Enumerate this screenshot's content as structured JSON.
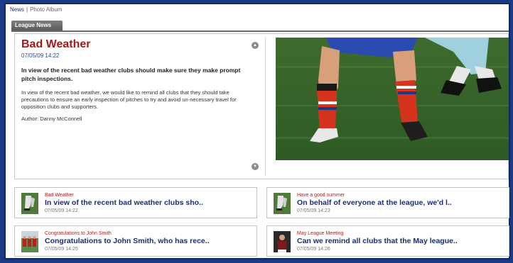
{
  "nav": {
    "news": "News",
    "separator": "|",
    "photo_album": "Photo Album"
  },
  "tab": {
    "label": "League News"
  },
  "feature": {
    "title": "Bad Weather",
    "date": "07/05/09 14:22",
    "lead": "In view of the recent bad weather clubs should make sure they make prompt pitch inspections.",
    "body": "In view of the recent bad weather, we would like to remind all clubs that they should take precautions to ensure an early inspection of pitches to try and avoid un-necessary travel for opposition clubs and supporters.",
    "author": "Author: Danny McConnell",
    "scroll_up_icon": "chevron-up-icon",
    "scroll_down_icon": "chevron-down-icon"
  },
  "cards": [
    {
      "title": "Bad Weather",
      "headline": "In view of the recent bad weather clubs sho..",
      "date": "07/05/09 14:22",
      "thumb": "football-thumb-icon"
    },
    {
      "title": "Have a good summer",
      "headline": "On behalf of everyone at the league, we'd l..",
      "date": "07/05/09 14:23",
      "thumb": "football-thumb-icon"
    },
    {
      "title": "Congratulations to John Smith",
      "headline": "Congratulations to John Smith, who has rece..",
      "date": "07/05/09 14:25",
      "thumb": "team-thumb-icon"
    },
    {
      "title": "May League Meeting",
      "headline": "Can we remind all clubs that the May league..",
      "date": "07/05/09 14:26",
      "thumb": "player-thumb-icon"
    }
  ],
  "colors": {
    "frame_border": "#1b3a86",
    "title_red": "#a11a1a",
    "headline_blue": "#1c2f6b"
  }
}
